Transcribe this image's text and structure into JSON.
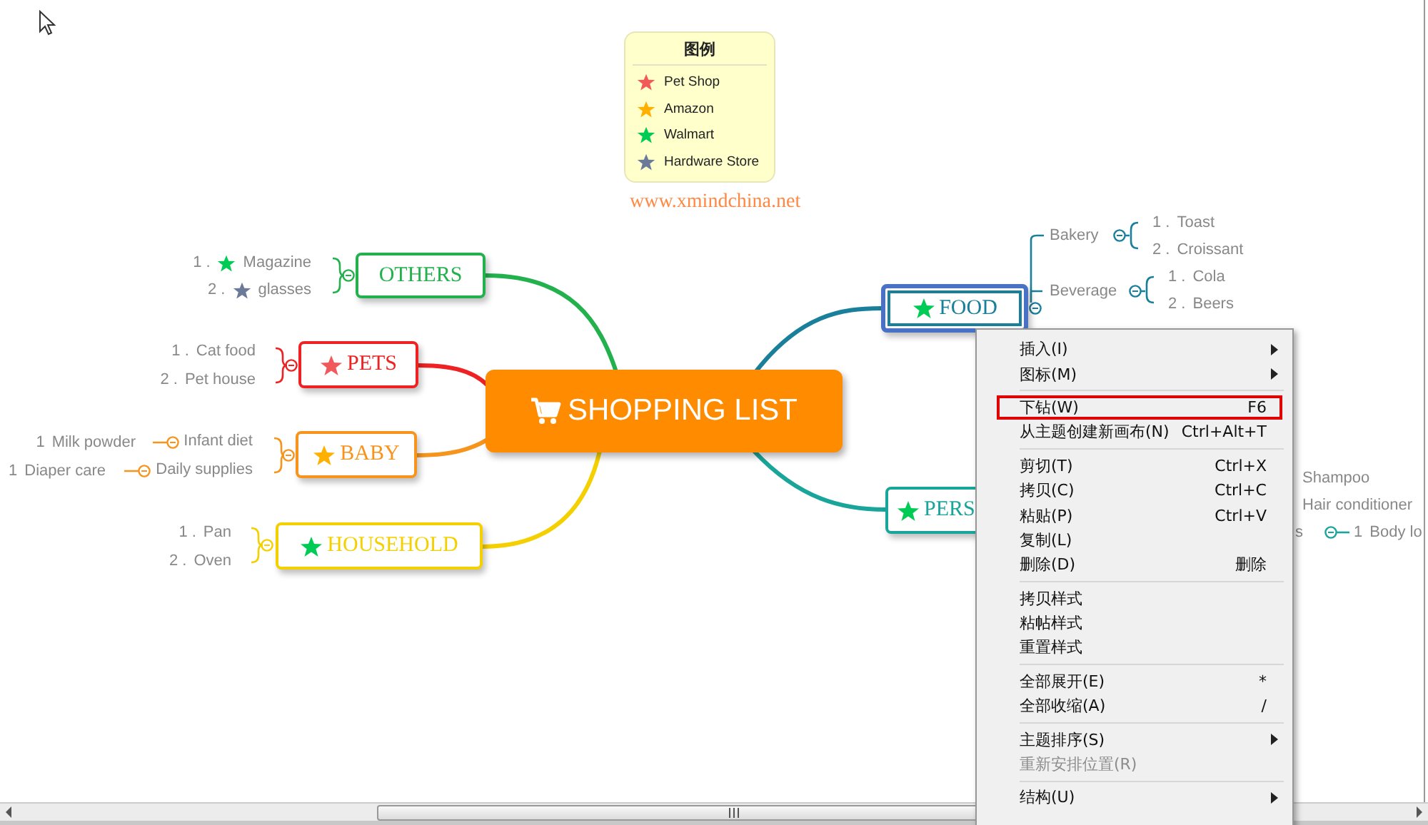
{
  "legend": {
    "title": "图例",
    "items": [
      {
        "label": "Pet Shop",
        "color": "#f05a5a"
      },
      {
        "label": "Amazon",
        "color": "#ffb000"
      },
      {
        "label": "Walmart",
        "color": "#00cc55"
      },
      {
        "label": "Hardware Store",
        "color": "#6b7a99"
      }
    ]
  },
  "site_note": "www.xmindchina.net",
  "central_topic": {
    "label": "SHOPPING LIST"
  },
  "branches": [
    {
      "label": "OTHERS",
      "color": "#22b14c",
      "selected": false,
      "children": [
        {
          "num": "1 .",
          "star": {
            "color": "#00cc55"
          },
          "label": "Magazine"
        },
        {
          "num": "2 .",
          "star": {
            "color": "#6b7a99"
          },
          "label": "glasses"
        }
      ]
    },
    {
      "label": "PETS",
      "color": "#ee2222",
      "star": {
        "color": "#f05a5a"
      },
      "selected": false,
      "children": [
        {
          "num": "1 .",
          "label": "Cat food"
        },
        {
          "num": "2 .",
          "label": "Pet house"
        }
      ]
    },
    {
      "label": "BABY",
      "color": "#f7941d",
      "star": {
        "color": "#ffb000"
      },
      "selected": false,
      "children": [
        {
          "label": "Infant diet",
          "children": [
            {
              "num": "1",
              "label": "Milk powder"
            }
          ]
        },
        {
          "label": "Daily supplies",
          "children": [
            {
              "num": "1",
              "label": "Diaper care"
            }
          ]
        }
      ]
    },
    {
      "label": "HOUSEHOLD",
      "color": "#f5d000",
      "star": {
        "color": "#00cc55"
      },
      "selected": false,
      "children": [
        {
          "num": "1 .",
          "label": "Pan"
        },
        {
          "num": "2 .",
          "label": "Oven"
        }
      ]
    },
    {
      "label": "FOOD",
      "color": "#1a7f9a",
      "star": {
        "color": "#00cc55"
      },
      "selected": true,
      "children": [
        {
          "label": "Bakery",
          "children": [
            {
              "num": "1 .",
              "label": "Toast"
            },
            {
              "num": "2 .",
              "label": "Croissant"
            }
          ]
        },
        {
          "label": "Beverage",
          "children": [
            {
              "num": "1 .",
              "label": "Cola"
            },
            {
              "num": "2 .",
              "label": "Beers"
            }
          ]
        }
      ]
    },
    {
      "label": "PERS",
      "color": "#1aa59a",
      "star": {
        "color": "#00cc55"
      },
      "selected": false,
      "children": [
        {
          "label": "Shampoo"
        },
        {
          "label": "Hair conditioner"
        },
        {
          "label": "s",
          "children": [
            {
              "num": "1",
              "label": "Body lo"
            }
          ]
        }
      ]
    }
  ],
  "context_menu": {
    "items": [
      {
        "kind": "item",
        "label": "插入(I)",
        "submenu": true,
        "disabled": false,
        "highlighted": false
      },
      {
        "kind": "item",
        "label": "图标(M)",
        "submenu": true,
        "disabled": false,
        "highlighted": false
      },
      {
        "kind": "separator"
      },
      {
        "kind": "item",
        "label": "下钻(W)",
        "shortcut": "F6",
        "submenu": false,
        "disabled": false,
        "highlighted": true
      },
      {
        "kind": "item",
        "label": "从主题创建新画布(N)",
        "shortcut": "Ctrl+Alt+T",
        "submenu": false,
        "disabled": false,
        "highlighted": false
      },
      {
        "kind": "separator"
      },
      {
        "kind": "item",
        "label": "剪切(T)",
        "shortcut": "Ctrl+X",
        "submenu": false,
        "disabled": false,
        "highlighted": false
      },
      {
        "kind": "item",
        "label": "拷贝(C)",
        "shortcut": "Ctrl+C",
        "submenu": false,
        "disabled": false,
        "highlighted": false
      },
      {
        "kind": "item",
        "label": "粘贴(P)",
        "shortcut": "Ctrl+V",
        "submenu": false,
        "disabled": false,
        "highlighted": false
      },
      {
        "kind": "item",
        "label": "复制(L)",
        "submenu": false,
        "disabled": false,
        "highlighted": false
      },
      {
        "kind": "item",
        "label": "删除(D)",
        "shortcut": "删除",
        "submenu": false,
        "disabled": false,
        "highlighted": false
      },
      {
        "kind": "separator"
      },
      {
        "kind": "item",
        "label": "拷贝样式",
        "submenu": false,
        "disabled": false,
        "highlighted": false
      },
      {
        "kind": "item",
        "label": "粘帖样式",
        "submenu": false,
        "disabled": false,
        "highlighted": false
      },
      {
        "kind": "item",
        "label": "重置样式",
        "submenu": false,
        "disabled": false,
        "highlighted": false
      },
      {
        "kind": "separator"
      },
      {
        "kind": "item",
        "label": "全部展开(E)",
        "shortcut": "*",
        "submenu": false,
        "disabled": false,
        "highlighted": false
      },
      {
        "kind": "item",
        "label": "全部收缩(A)",
        "shortcut": "/",
        "submenu": false,
        "disabled": false,
        "highlighted": false
      },
      {
        "kind": "separator"
      },
      {
        "kind": "item",
        "label": "主题排序(S)",
        "submenu": true,
        "disabled": false,
        "highlighted": false
      },
      {
        "kind": "item",
        "label": "重新安排位置(R)",
        "submenu": false,
        "disabled": true,
        "highlighted": false
      },
      {
        "kind": "separator"
      },
      {
        "kind": "item",
        "label": "结构(U)",
        "submenu": true,
        "disabled": false,
        "highlighted": false
      }
    ]
  }
}
